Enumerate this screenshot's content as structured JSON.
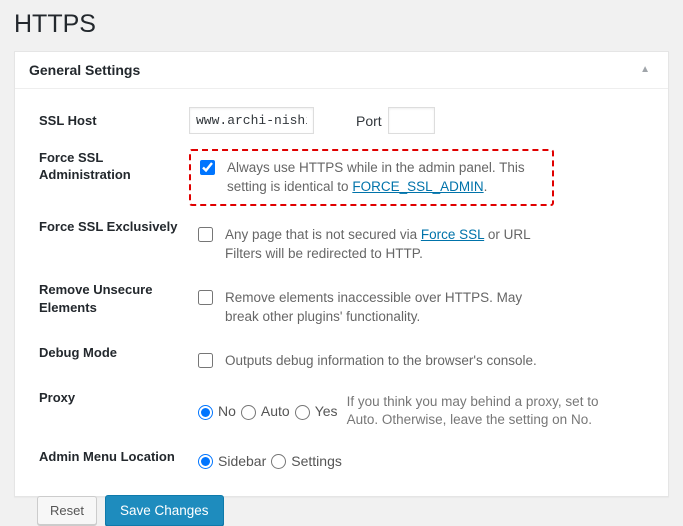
{
  "page": {
    "title": "HTTPS",
    "background_color": "#f1f1f1"
  },
  "panel": {
    "title": "General Settings",
    "collapse_icon": "▲"
  },
  "rows": {
    "ssl_host": {
      "label": "SSL Host",
      "value": "www.archi-nishi.com",
      "placeholder": "",
      "port_label": "Port",
      "port_value": "",
      "port_placeholder": ""
    },
    "force_ssl_admin": {
      "label": "Force SSL Administration",
      "checked": true,
      "text_before": "Always use HTTPS while in the admin panel. This setting is identical to ",
      "link_text": "FORCE_SSL_ADMIN",
      "text_after": ".",
      "highlighted": true,
      "highlight_color": "#e00000"
    },
    "force_ssl_exclusively": {
      "label": "Force SSL Exclusively",
      "checked": false,
      "text_before": "Any page that is not secured via ",
      "link_text": "Force SSL",
      "text_after": " or URL Filters will be redirected to HTTP."
    },
    "remove_unsecure_elements": {
      "label": "Remove Unsecure Elements",
      "checked": false,
      "text": "Remove elements inaccessible over HTTPS. May break other plugins' functionality."
    },
    "debug_mode": {
      "label": "Debug Mode",
      "checked": false,
      "text": "Outputs debug information to the browser's console."
    },
    "proxy": {
      "label": "Proxy",
      "options": [
        "No",
        "Auto",
        "Yes"
      ],
      "selected": "No",
      "help_text": "If you think you may behind a proxy, set to Auto. Otherwise, leave the setting on No."
    },
    "admin_menu_location": {
      "label": "Admin Menu Location",
      "options": [
        "Sidebar",
        "Settings"
      ],
      "selected": "Sidebar"
    }
  },
  "buttons": {
    "reset": "Reset",
    "save": "Save Changes",
    "save_color": "#1e8cbe"
  }
}
